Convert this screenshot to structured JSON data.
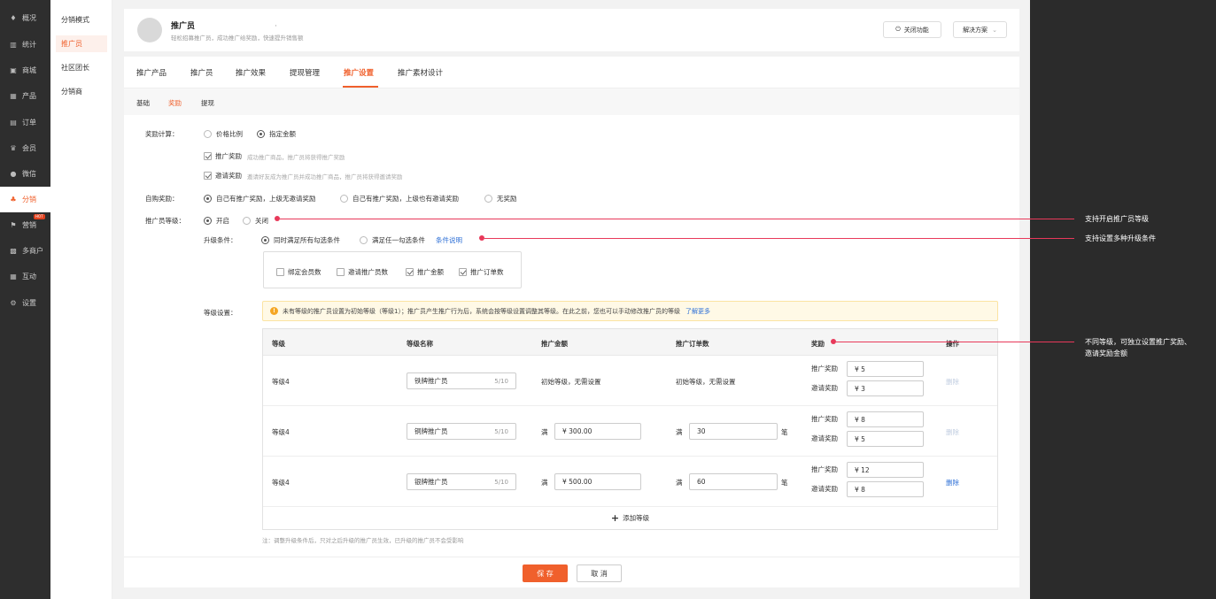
{
  "sidebar": {
    "items": [
      {
        "label": "概况",
        "icon": "graduation-icon"
      },
      {
        "label": "统计",
        "icon": "bar-chart-icon"
      },
      {
        "label": "商城",
        "icon": "store-icon"
      },
      {
        "label": "产品",
        "icon": "grid-icon"
      },
      {
        "label": "订单",
        "icon": "clipboard-icon"
      },
      {
        "label": "会员",
        "icon": "crown-icon"
      },
      {
        "label": "微信",
        "icon": "wechat-icon"
      },
      {
        "label": "分销",
        "icon": "users-icon"
      },
      {
        "label": "营销",
        "icon": "flag-icon",
        "badge": "HOT"
      },
      {
        "label": "多商户",
        "icon": "shop-icon"
      },
      {
        "label": "互动",
        "icon": "grid-icon"
      },
      {
        "label": "设置",
        "icon": "gear-icon"
      }
    ]
  },
  "subnav": {
    "items": [
      "分销模式",
      "推广员",
      "社区团长",
      "分销商"
    ]
  },
  "header": {
    "title": "推广员",
    "dot": "·",
    "subtitle": "轻松招募推广员，成功推广给奖励，快速提升销售额",
    "close_btn": "关闭功能",
    "solution_btn": "解决方案"
  },
  "tabs": [
    "推广产品",
    "推广员",
    "推广效果",
    "提现管理",
    "推广设置",
    "推广素材设计"
  ],
  "subtabs": [
    "基础",
    "奖励",
    "提现"
  ],
  "form": {
    "reward_calc": {
      "label": "奖励计算：",
      "options": [
        "价格比例",
        "指定金额"
      ]
    },
    "promo_reward": {
      "label": "推广奖励",
      "desc": "成功推广商品，推广员将获得推广奖励"
    },
    "invite_reward": {
      "label": "邀请奖励",
      "desc": "邀请好友成为推广员并成功推广商品，推广员将获得邀请奖励"
    },
    "self_buy": {
      "label": "自购奖励：",
      "options": [
        "自己有推广奖励，上级无邀请奖励",
        "自己有推广奖励，上级也有邀请奖励",
        "无奖励"
      ]
    },
    "level": {
      "label": "推广员等级：",
      "options": [
        "开启",
        "关闭"
      ]
    },
    "upgrade": {
      "label": "升级条件：",
      "options": [
        "同时满足所有勾选条件",
        "满足任一勾选条件"
      ],
      "link": "条件说明"
    },
    "conditions": [
      "绑定会员数",
      "邀请推广员数",
      "推广金额",
      "推广订单数"
    ],
    "level_settings_label": "等级设置："
  },
  "alert": {
    "text": "未有等级的推广员设置为初始等级（等级1）；推广员产生推广行为后，系统会按等级设置调整其等级。在此之前，您也可以手动修改推广员的等级",
    "link": "了解更多"
  },
  "table": {
    "headers": [
      "等级",
      "等级名称",
      "推广金额",
      "推广订单数",
      "奖励",
      "操作"
    ],
    "rows": [
      {
        "level": "等级4",
        "name": "铁牌推广员",
        "count": "5/10",
        "amount_text": "初始等级，无需设置",
        "orders_text": "初始等级，无需设置",
        "promo_label": "推广奖励",
        "promo": "¥  5",
        "invite_label": "邀请奖励",
        "invite": "¥  3",
        "action": "删除"
      },
      {
        "level": "等级4",
        "name": "铜牌推广员",
        "count": "5/10",
        "amount_prefix": "满",
        "amount": "¥   300.00",
        "orders_prefix": "满",
        "orders": "30",
        "orders_unit": "笔",
        "promo_label": "推广奖励",
        "promo": "¥  8",
        "invite_label": "邀请奖励",
        "invite": "¥  5",
        "action": "删除"
      },
      {
        "level": "等级4",
        "name": "银牌推广员",
        "count": "5/10",
        "amount_prefix": "满",
        "amount": "¥   500.00",
        "orders_prefix": "满",
        "orders": "60",
        "orders_unit": "笔",
        "promo_label": "推广奖励",
        "promo": "¥  12",
        "invite_label": "邀请奖励",
        "invite": "¥  8",
        "action": "删除"
      }
    ],
    "add_label": "添加等级"
  },
  "note": "注：调整升级条件后，只对之后升级的推广员生效，已升级的推广员不会受影响",
  "footer": {
    "save": "保 存",
    "cancel": "取 消"
  },
  "callouts": [
    {
      "text": "支持开启推广员等级"
    },
    {
      "text": "支持设置多种升级条件"
    },
    {
      "line1": "不同等级，可独立设置推广奖励、",
      "line2": "邀请奖励金额"
    }
  ],
  "colors": {
    "accent": "#f0602c",
    "callout": "#e8395a",
    "link": "#2d6fd6"
  }
}
